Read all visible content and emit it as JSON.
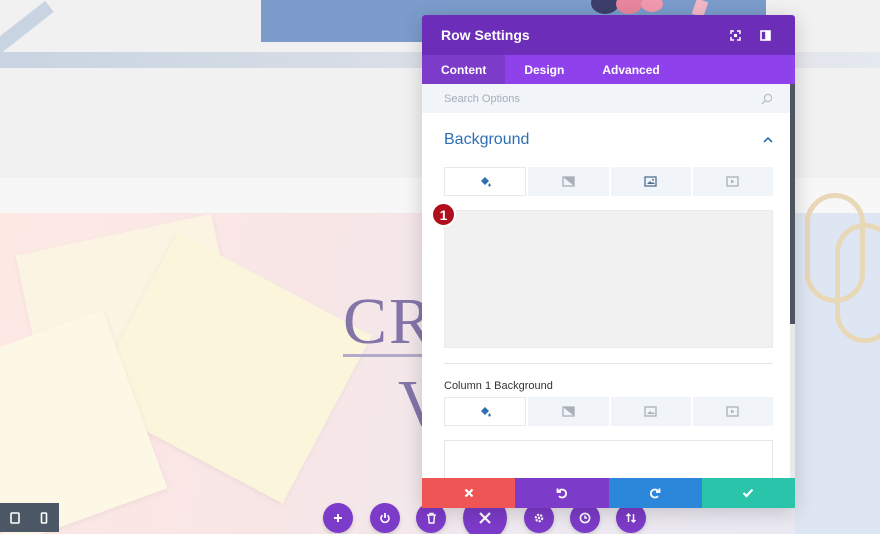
{
  "modal": {
    "title": "Row Settings",
    "tabs": [
      {
        "label": "Content",
        "active": true
      },
      {
        "label": "Design",
        "active": false
      },
      {
        "label": "Advanced",
        "active": false
      }
    ],
    "search": {
      "placeholder": "Search Options"
    },
    "section": {
      "title": "Background",
      "bg_tab_icons": [
        "paint-bucket-icon",
        "gradient-icon",
        "image-icon",
        "video-icon"
      ],
      "column_label": "Column 1 Background"
    }
  },
  "annotation": {
    "badge_number": "1"
  },
  "page": {
    "hero_line1": "CR",
    "hero_line2": "V"
  },
  "colors": {
    "header_purple": "#6c2eb9",
    "tab_purple": "#8f42ec",
    "section_title_blue": "#2e6fb3",
    "footer_cancel": "#ef5555",
    "footer_undo": "#7d3bc9",
    "footer_redo": "#2b87da",
    "footer_save": "#29c4a9",
    "badge_red": "#b00e1c"
  }
}
